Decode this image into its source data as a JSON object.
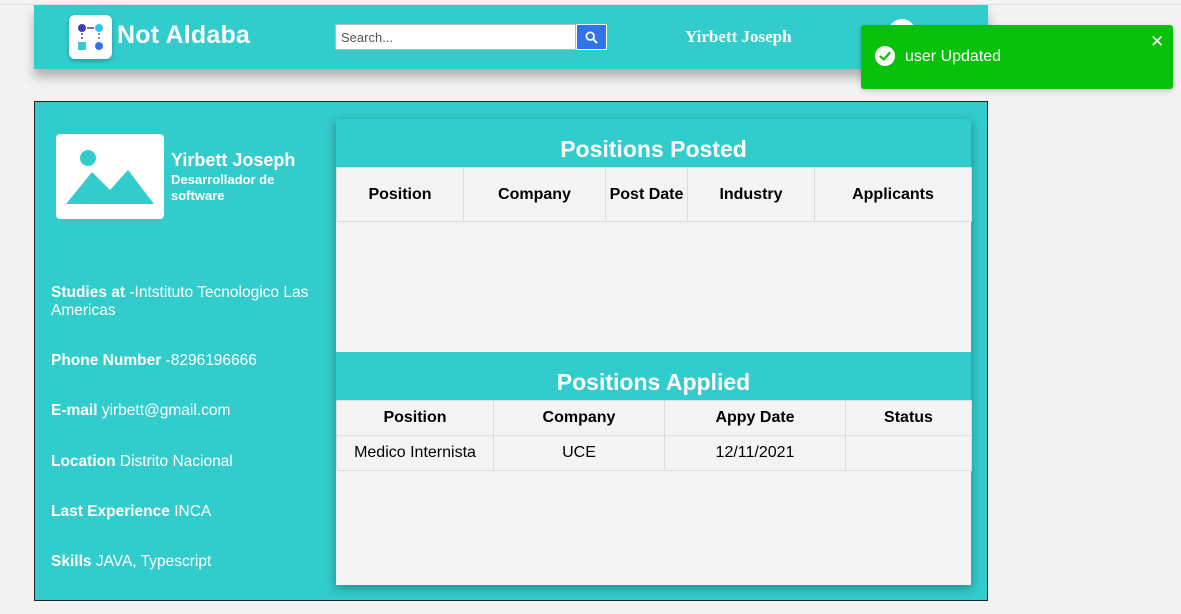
{
  "header": {
    "brand": "Not Aldaba",
    "search_placeholder": "Search...",
    "user_name": "Yirbett Joseph",
    "color": "#33cccc"
  },
  "profile": {
    "name": "Yirbett Joseph",
    "title": "Desarrollador de software",
    "fields": [
      {
        "label": "Studies at",
        "value": "-Intstituto Tecnologico Las Americas"
      },
      {
        "label": "Phone Number",
        "value": "-8296196666"
      },
      {
        "label": "E-mail",
        "value": "yirbett@gmail.com"
      },
      {
        "label": "Location",
        "value": "Distrito Nacional"
      },
      {
        "label": "Last Experience",
        "value": "INCA"
      },
      {
        "label": "Skills",
        "value": "JAVA, Typescript"
      }
    ]
  },
  "positions_posted": {
    "title": "Positions Posted",
    "columns": [
      "Position",
      "Company",
      "Post Date",
      "Industry",
      "Applicants"
    ],
    "rows": []
  },
  "positions_applied": {
    "title": "Positions Applied",
    "columns": [
      "Position",
      "Company",
      "Appy Date",
      "Status"
    ],
    "rows": [
      [
        "Medico Internista",
        "UCE",
        "12/11/2021",
        ""
      ]
    ]
  },
  "toast": {
    "message": "user Updated",
    "color": "#08c10a",
    "icon": "check-circle-icon",
    "close": "✕"
  }
}
